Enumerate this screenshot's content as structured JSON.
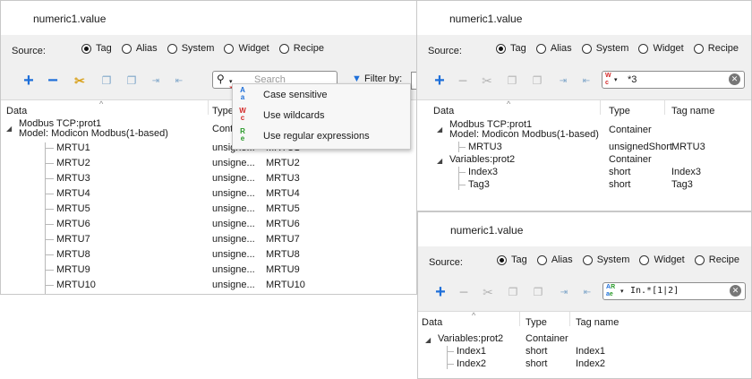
{
  "left_panel": {
    "title": "numeric1.value",
    "source_label": "Source:",
    "radios": [
      "Tag",
      "Alias",
      "System",
      "Widget",
      "Recipe"
    ],
    "selected": "Tag",
    "search_placeholder": "Search",
    "filter_label": "Filter by:",
    "columns": [
      "Data",
      "Type",
      "Tag name"
    ],
    "container_line1": "Modbus TCP:prot1",
    "container_line2": "Model: Modicon Modbus(1-based)",
    "container_type": "Cont",
    "rows": [
      {
        "data": "MRTU1",
        "type": "unsigne...",
        "tag": "MRTU1"
      },
      {
        "data": "MRTU2",
        "type": "unsigne...",
        "tag": "MRTU2"
      },
      {
        "data": "MRTU3",
        "type": "unsigne...",
        "tag": "MRTU3"
      },
      {
        "data": "MRTU4",
        "type": "unsigne...",
        "tag": "MRTU4"
      },
      {
        "data": "MRTU5",
        "type": "unsigne...",
        "tag": "MRTU5"
      },
      {
        "data": "MRTU6",
        "type": "unsigne...",
        "tag": "MRTU6"
      },
      {
        "data": "MRTU7",
        "type": "unsigne...",
        "tag": "MRTU7"
      },
      {
        "data": "MRTU8",
        "type": "unsigne...",
        "tag": "MRTU8"
      },
      {
        "data": "MRTU9",
        "type": "unsigne...",
        "tag": "MRTU9"
      },
      {
        "data": "MRTU10",
        "type": "unsigne...",
        "tag": "MRTU10"
      }
    ],
    "menu": [
      {
        "icon_top": "A",
        "icon_bottom": "a",
        "label": "Case sensitive",
        "color": "#1e6fd9"
      },
      {
        "icon_top": "W",
        "icon_bottom": "c",
        "label": "Use wildcards",
        "color": "#d42a2a"
      },
      {
        "icon_top": "R",
        "icon_bottom": "e",
        "label": "Use regular expressions",
        "color": "#2a9a2a"
      }
    ]
  },
  "right_top": {
    "title": "numeric1.value",
    "source_label": "Source:",
    "radios": [
      "Tag",
      "Alias",
      "System",
      "Widget",
      "Recipe"
    ],
    "search_value": "*3",
    "columns": [
      "Data",
      "Type",
      "Tag name"
    ],
    "rows": [
      {
        "data": "Modbus TCP:prot1",
        "data2": "Model: Modicon Modbus(1-based)",
        "type": "Container",
        "tag": ""
      },
      {
        "data": "MRTU3",
        "type": "unsignedShort",
        "tag": "MRTU3"
      },
      {
        "data": "Variables:prot2",
        "type": "Container",
        "tag": ""
      },
      {
        "data": "Index3",
        "type": "short",
        "tag": "Index3"
      },
      {
        "data": "Tag3",
        "type": "short",
        "tag": "Tag3"
      }
    ]
  },
  "right_bottom": {
    "title": "numeric1.value",
    "source_label": "Source:",
    "radios": [
      "Tag",
      "Alias",
      "System",
      "Widget",
      "Recipe"
    ],
    "search_value": "In.*[1|2]",
    "columns": [
      "Data",
      "Type",
      "Tag name"
    ],
    "rows": [
      {
        "data": "Variables:prot2",
        "type": "Container",
        "tag": ""
      },
      {
        "data": "Index1",
        "type": "short",
        "tag": "Index1"
      },
      {
        "data": "Index2",
        "type": "short",
        "tag": "Index2"
      }
    ]
  }
}
